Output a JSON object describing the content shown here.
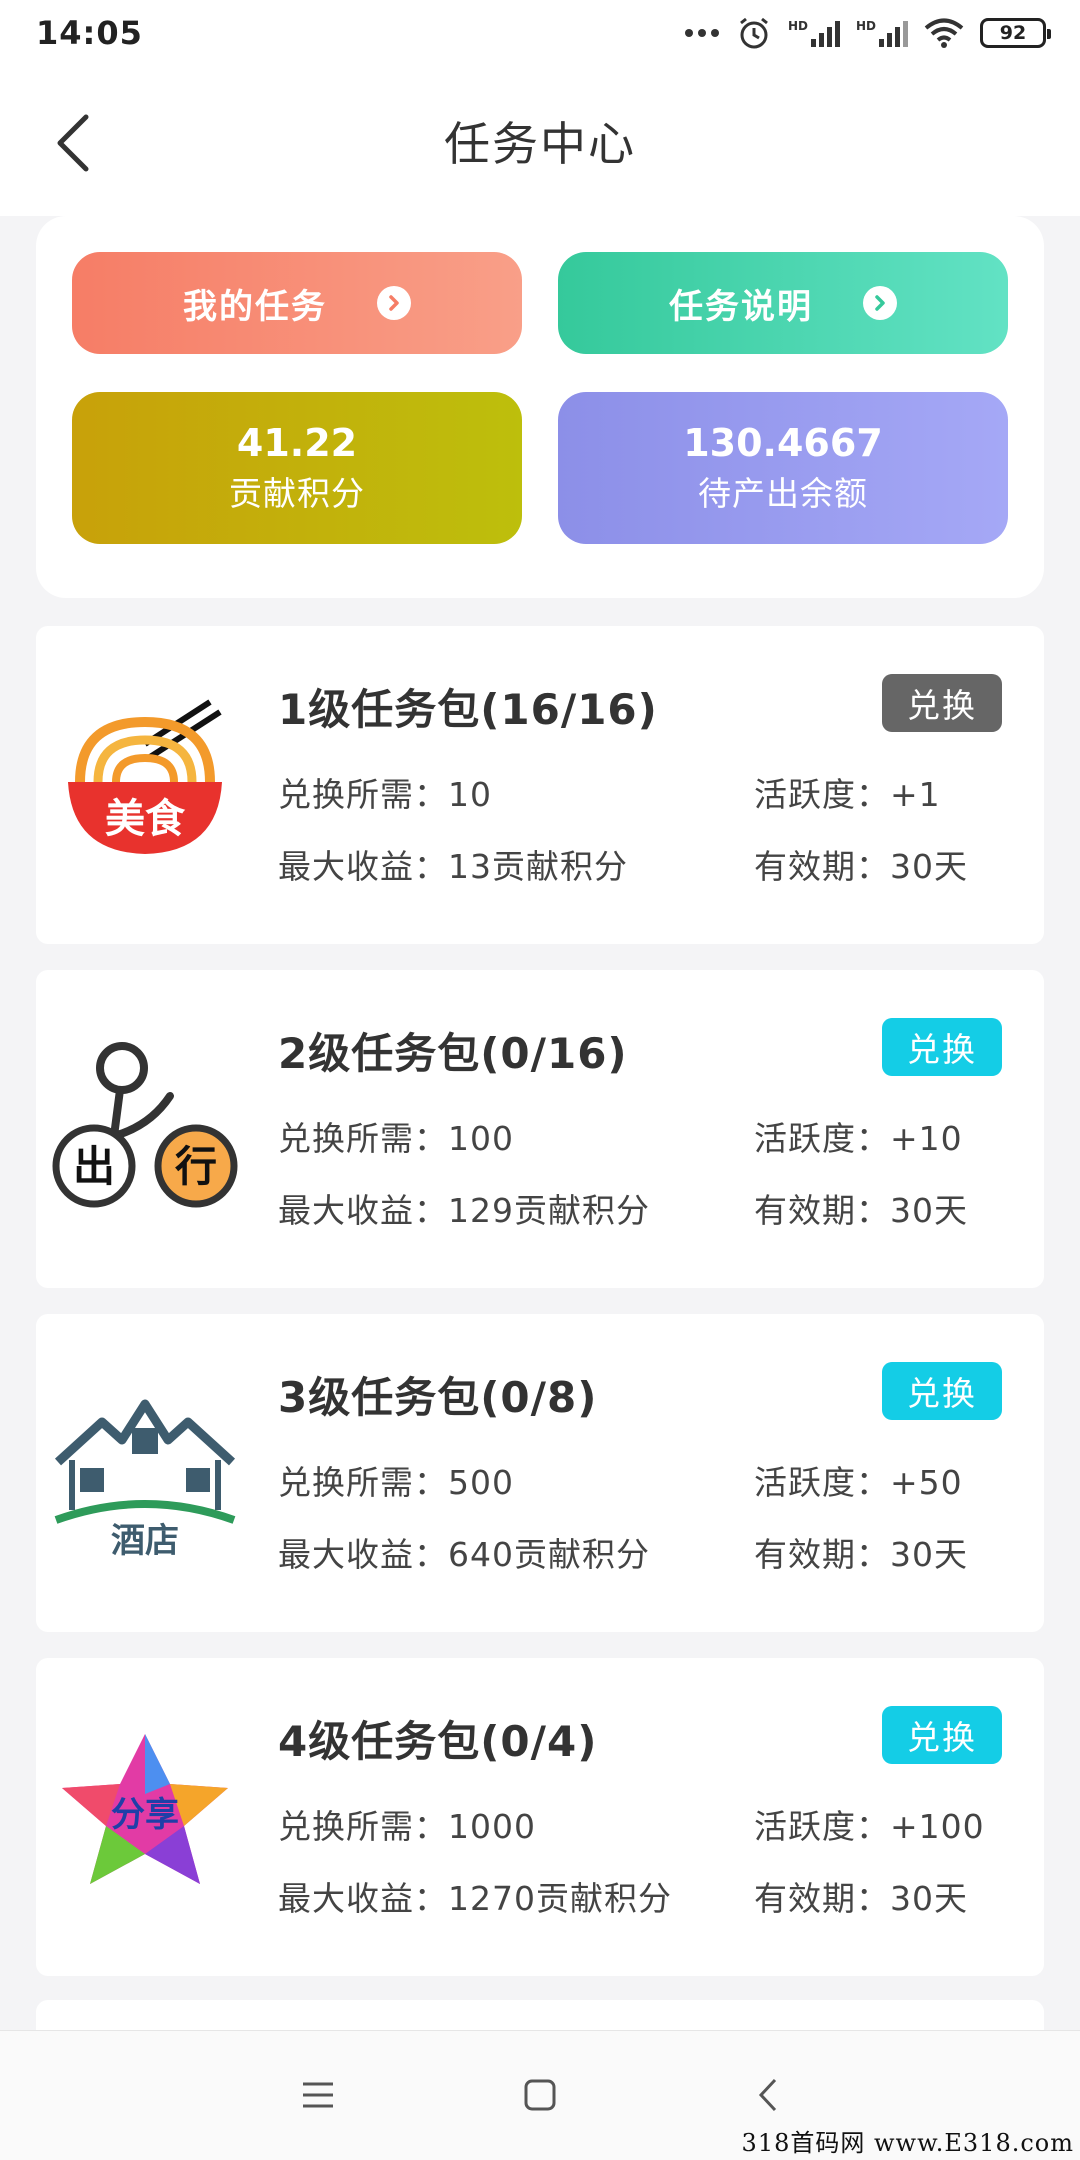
{
  "status_bar": {
    "time": "14:05",
    "battery": "92",
    "signal_labels": [
      "HD",
      "HD"
    ]
  },
  "header": {
    "title": "任务中心"
  },
  "top_card": {
    "my_tasks_label": "我的任务",
    "task_explain_label": "任务说明",
    "contribution": {
      "value": "41.22",
      "label": "贡献积分"
    },
    "pending": {
      "value": "130.4667",
      "label": "待产出余额"
    }
  },
  "tasks": [
    {
      "title": "1级任务包(16/16)",
      "button": "兑换",
      "button_state": "done",
      "cost": "兑换所需：10",
      "activity": "活跃度：+1",
      "max_income": "最大收益：13贡献积分",
      "validity": "有效期：30天",
      "logo": "food-icon",
      "logo_text": "美食"
    },
    {
      "title": "2级任务包(0/16)",
      "button": "兑换",
      "button_state": "active",
      "cost": "兑换所需：100",
      "activity": "活跃度：+10",
      "max_income": "最大收益：129贡献积分",
      "validity": "有效期：30天",
      "logo": "travel-icon",
      "logo_text": [
        "出",
        "行"
      ]
    },
    {
      "title": "3级任务包(0/8)",
      "button": "兑换",
      "button_state": "active",
      "cost": "兑换所需：500",
      "activity": "活跃度：+50",
      "max_income": "最大收益：640贡献积分",
      "validity": "有效期：30天",
      "logo": "hotel-icon",
      "logo_text": "酒店"
    },
    {
      "title": "4级任务包(0/4)",
      "button": "兑换",
      "button_state": "active",
      "cost": "兑换所需：1000",
      "activity": "活跃度：+100",
      "max_income": "最大收益：1270贡献积分",
      "validity": "有效期：30天",
      "logo": "share-icon",
      "logo_text": "分享"
    }
  ],
  "colors": {
    "my_tasks": "#f67d66",
    "task_explain": "#35c99b",
    "contribution": "#c8a10a",
    "pending": "#8c8fe8",
    "btn_done": "#666666",
    "btn_active": "#14cde6"
  },
  "watermark": "318首码网 www.E318.com"
}
